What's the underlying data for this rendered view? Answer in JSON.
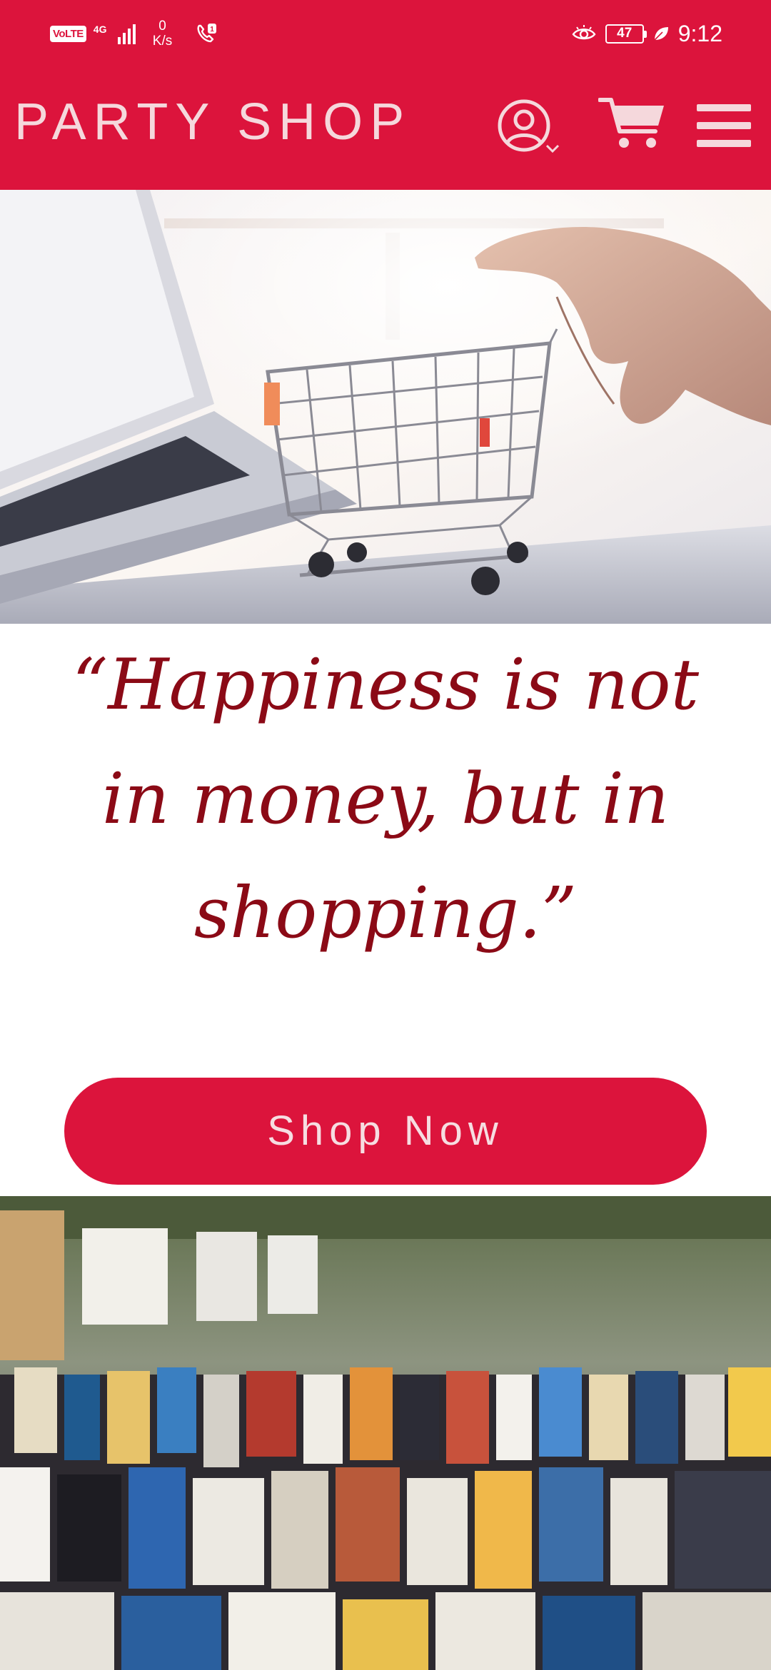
{
  "status_bar": {
    "volte": "VoLTE",
    "network": "4G",
    "speed_value": "0",
    "speed_unit": "K/s",
    "battery": "47",
    "time": "9:12"
  },
  "header": {
    "brand": "PARTY SHOP"
  },
  "icons": {
    "account": "account-icon",
    "cart": "cart-icon",
    "menu": "hamburger-menu-icon"
  },
  "quote": {
    "text": "“Happiness is not in money, but in shopping.”"
  },
  "cta": {
    "label": "Shop Now"
  },
  "colors": {
    "brand_red": "#dc143c",
    "quote_color": "#8b0a16",
    "header_text": "#f5d8dc"
  }
}
